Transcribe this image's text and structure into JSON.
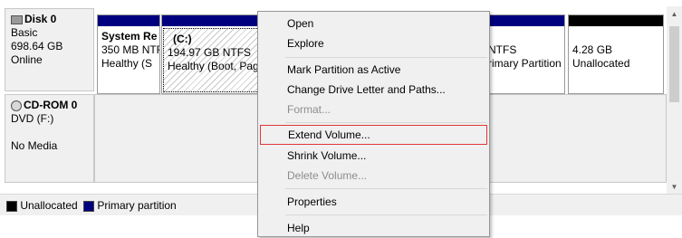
{
  "disk0": {
    "name": "Disk 0",
    "type": "Basic",
    "size": "698.64 GB",
    "status": "Online",
    "partitions": [
      {
        "name": "System Re",
        "size": "350 MB NTF",
        "status": "Healthy (S"
      },
      {
        "name": "(C:)",
        "size": "194.97 GB NTFS",
        "status": "Healthy (Boot, Pag"
      },
      {
        "name": "",
        "size": "NTFS",
        "status": "rimary Partition"
      },
      {
        "name": "",
        "size": "4.28 GB",
        "status": "Unallocated"
      }
    ]
  },
  "cdrom0": {
    "name": "CD-ROM 0",
    "type": "DVD (F:)",
    "status": "No Media"
  },
  "legend": {
    "unallocated": "Unallocated",
    "primary": "Primary partition"
  },
  "colors": {
    "primary": "#00007f",
    "unallocated": "#000000",
    "menu_highlight_border": "#e03636"
  },
  "context_menu": {
    "open": "Open",
    "explore": "Explore",
    "mark_active": "Mark Partition as Active",
    "change_letter": "Change Drive Letter and Paths...",
    "format": "Format...",
    "extend": "Extend Volume...",
    "shrink": "Shrink Volume...",
    "delete": "Delete Volume...",
    "properties": "Properties",
    "help": "Help"
  },
  "icons": {
    "disk": "hard-disk-icon",
    "cdrom": "cd-rom-icon",
    "scroll_up": "scroll-up-arrow-icon",
    "scroll_down": "scroll-down-arrow-icon"
  }
}
